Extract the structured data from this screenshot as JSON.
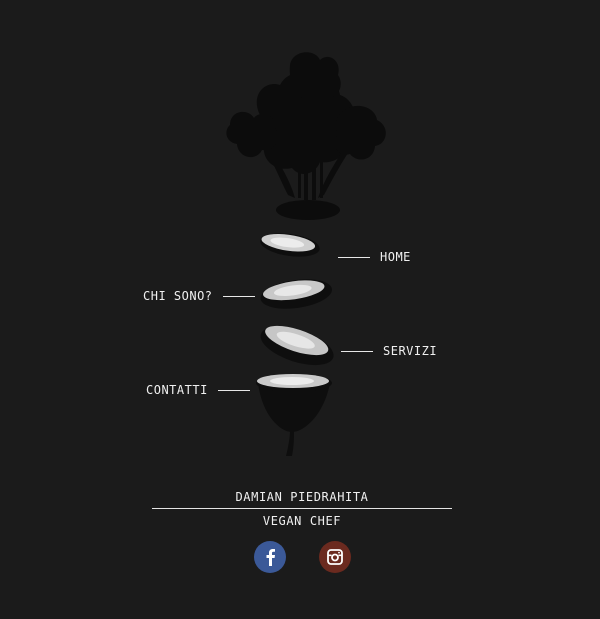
{
  "nav": {
    "home": "HOME",
    "chi_sono": "CHI SONO?",
    "servizi": "SERVIZI",
    "contatti": "CONTATTI"
  },
  "footer": {
    "name": "DAMIAN PIEDRAHITA",
    "role": "VEGAN CHEF"
  },
  "social": {
    "facebook_icon": "facebook-icon",
    "instagram_icon": "instagram-icon",
    "facebook_color": "#3b5998",
    "instagram_color": "#6b2a1f"
  },
  "colors": {
    "background": "#1b1b1b",
    "text": "#f0f0f0"
  }
}
